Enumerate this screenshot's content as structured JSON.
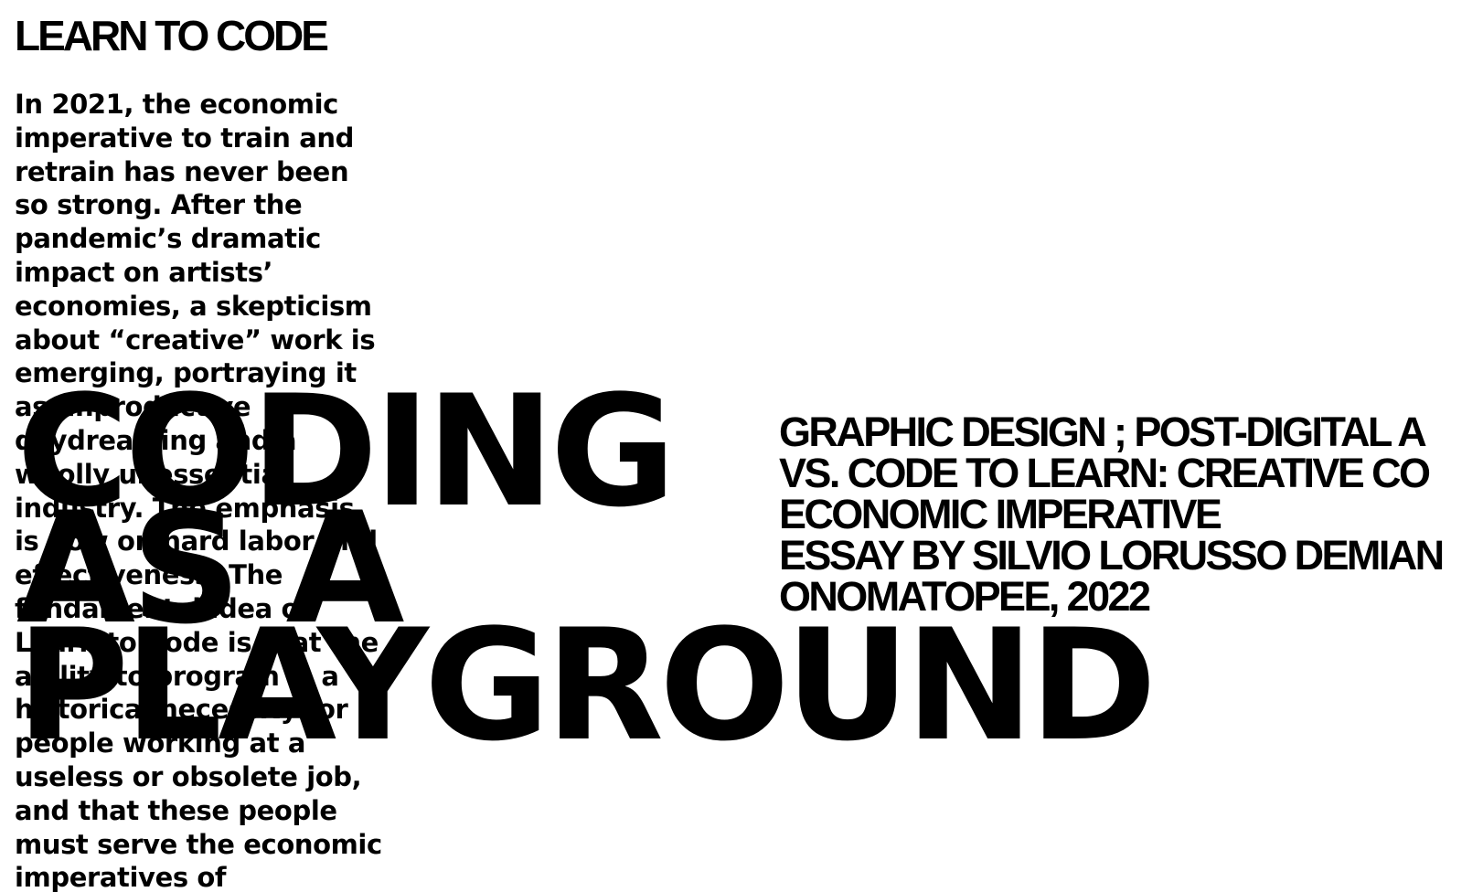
{
  "page": {
    "section_title": "LEARN TO CODE",
    "body_text": "In 2021, the economic imperative to train and retrain has never been so strong. After the pandemic’s dramatic impact on artists’ economies, a skepticism about “creative” work is emerging, portraying it as unproductive daydreaming and a wholly unessential industry. The emphasis is now on hard labor and effectiveness. The fundamental idea of Learn to Code is that the ability to program is a historical necessity for people working at a useless or obsolete job, and that these people must serve the economic imperatives of capitalism.",
    "headline": {
      "line1": "CODING",
      "line2": "AS A",
      "line3": "PLAYGROUND"
    },
    "meta": {
      "line1": "GRAPHIC DESIGN ; POST-DIGITAL A",
      "line2": "VS. CODE TO LEARN: CREATIVE CO",
      "line3": "ECONOMIC IMPERATIVE",
      "line4": "ESSAY BY SILVIO LORUSSO DEMIAN",
      "line5": "ONOMATOPEE, 2022"
    }
  },
  "colors": {
    "background": "#ffffff",
    "text": "#000000"
  }
}
